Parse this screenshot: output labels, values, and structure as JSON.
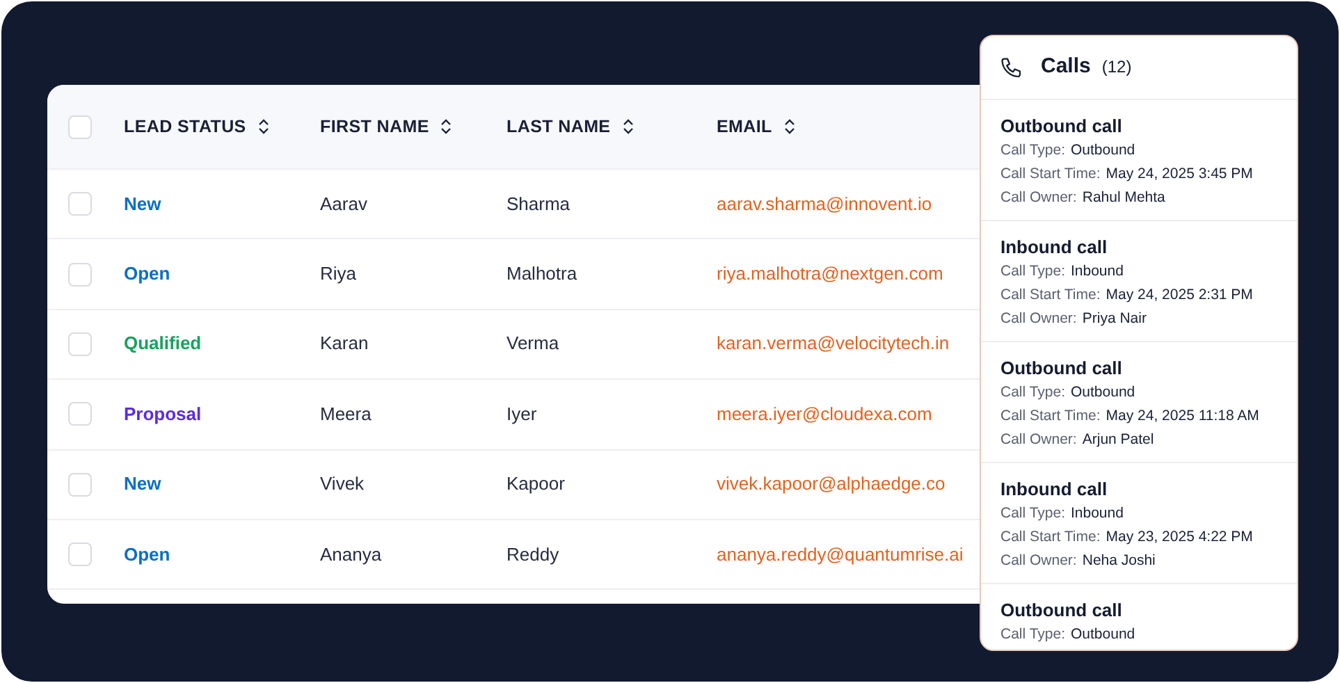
{
  "table": {
    "columns": [
      {
        "label": "LEAD STATUS",
        "sortable": true
      },
      {
        "label": "FIRST NAME",
        "sortable": true
      },
      {
        "label": "LAST NAME",
        "sortable": true
      },
      {
        "label": "EMAIL",
        "sortable": true
      }
    ],
    "header_checked": false,
    "rows": [
      {
        "checked": false,
        "status": "New",
        "color": "#0b6fc6",
        "first_name": "Aarav",
        "last_name": "Sharma",
        "email": "aarav.sharma@innovent.io"
      },
      {
        "checked": false,
        "status": "Open",
        "color": "#0b6fc6",
        "first_name": "Riya",
        "last_name": "Malhotra",
        "email": "riya.malhotra@nextgen.com"
      },
      {
        "checked": false,
        "status": "Qualified",
        "color": "#17a35e",
        "first_name": "Karan",
        "last_name": "Verma",
        "email": "karan.verma@velocitytech.in"
      },
      {
        "checked": false,
        "status": "Proposal",
        "color": "#5a2be2",
        "first_name": "Meera",
        "last_name": "Iyer",
        "email": "meera.iyer@cloudexa.com"
      },
      {
        "checked": false,
        "status": "New",
        "color": "#0b6fc6",
        "first_name": "Vivek",
        "last_name": "Kapoor",
        "email": "vivek.kapoor@alphaedge.co"
      },
      {
        "checked": false,
        "status": "Open",
        "color": "#0b6fc6",
        "first_name": "Ananya",
        "last_name": "Reddy",
        "email": "ananya.reddy@quantumrise.ai"
      }
    ]
  },
  "calls_panel": {
    "title": "Calls",
    "count": "(12)",
    "calls": [
      {
        "title": "Outbound call",
        "fields": [
          {
            "label": "Call Type:",
            "value": "Outbound"
          },
          {
            "label": "Call Start Time:",
            "value": "May 24, 2025 3:45 PM"
          },
          {
            "label": "Call Owner:",
            "value": "Rahul Mehta"
          }
        ]
      },
      {
        "title": "Inbound call",
        "fields": [
          {
            "label": "Call Type:",
            "value": "Inbound"
          },
          {
            "label": "Call Start Time:",
            "value": "May 24, 2025 2:31 PM"
          },
          {
            "label": "Call Owner:",
            "value": "Priya Nair"
          }
        ]
      },
      {
        "title": "Outbound call",
        "fields": [
          {
            "label": "Call Type:",
            "value": "Outbound"
          },
          {
            "label": "Call Start Time:",
            "value": "May 24, 2025 11:18 AM"
          },
          {
            "label": "Call Owner:",
            "value": "Arjun Patel"
          }
        ]
      },
      {
        "title": "Inbound call",
        "fields": [
          {
            "label": "Call Type:",
            "value": "Inbound"
          },
          {
            "label": "Call Start Time:",
            "value": "May 23, 2025 4:22 PM"
          },
          {
            "label": "Call Owner:",
            "value": "Neha Joshi"
          }
        ]
      },
      {
        "title": "Outbound call",
        "fields": [
          {
            "label": "Call Type:",
            "value": "Outbound"
          }
        ]
      }
    ]
  }
}
